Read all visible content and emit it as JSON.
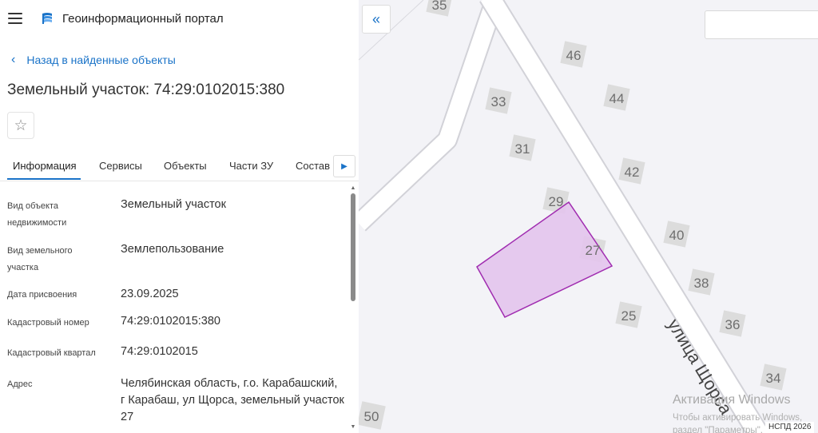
{
  "app": {
    "title": "Геоинформационный портал"
  },
  "nav": {
    "back_label": "Назад в найденные объекты"
  },
  "object": {
    "title": "Земельный участок: 74:29:0102015:380"
  },
  "tabs": [
    "Информация",
    "Сервисы",
    "Объекты",
    "Части ЗУ",
    "Состав"
  ],
  "info": [
    {
      "label": "Вид объекта недвижимости",
      "value": "Земельный участок"
    },
    {
      "label": "Вид земельного участка",
      "value": "Землепользование"
    },
    {
      "label": "Дата присвоения",
      "value": "23.09.2025"
    },
    {
      "label": "Кадастровый номер",
      "value": "74:29:0102015:380"
    },
    {
      "label": "Кадастровый квартал",
      "value": "74:29:0102015"
    },
    {
      "label": "Адрес",
      "value": "Челябинская область, г.о. Карабашский, г Карабаш, ул Щорса, земельный участок 27"
    }
  ],
  "map": {
    "street_label": "улица Щорса",
    "house_numbers": [
      "35",
      "46",
      "33",
      "44",
      "31",
      "42",
      "29",
      "27",
      "40",
      "38",
      "25",
      "36",
      "34",
      "50"
    ],
    "parcel_fill": "#e3c4ec",
    "parcel_stroke": "#a02cb0"
  },
  "watermark": {
    "title": "Активация Windows",
    "line1": "Чтобы активировать Windows,",
    "line2": "раздел \"Параметры\"."
  },
  "attribution": "НСПД 2026",
  "colors": {
    "accent": "#1a73c8"
  }
}
